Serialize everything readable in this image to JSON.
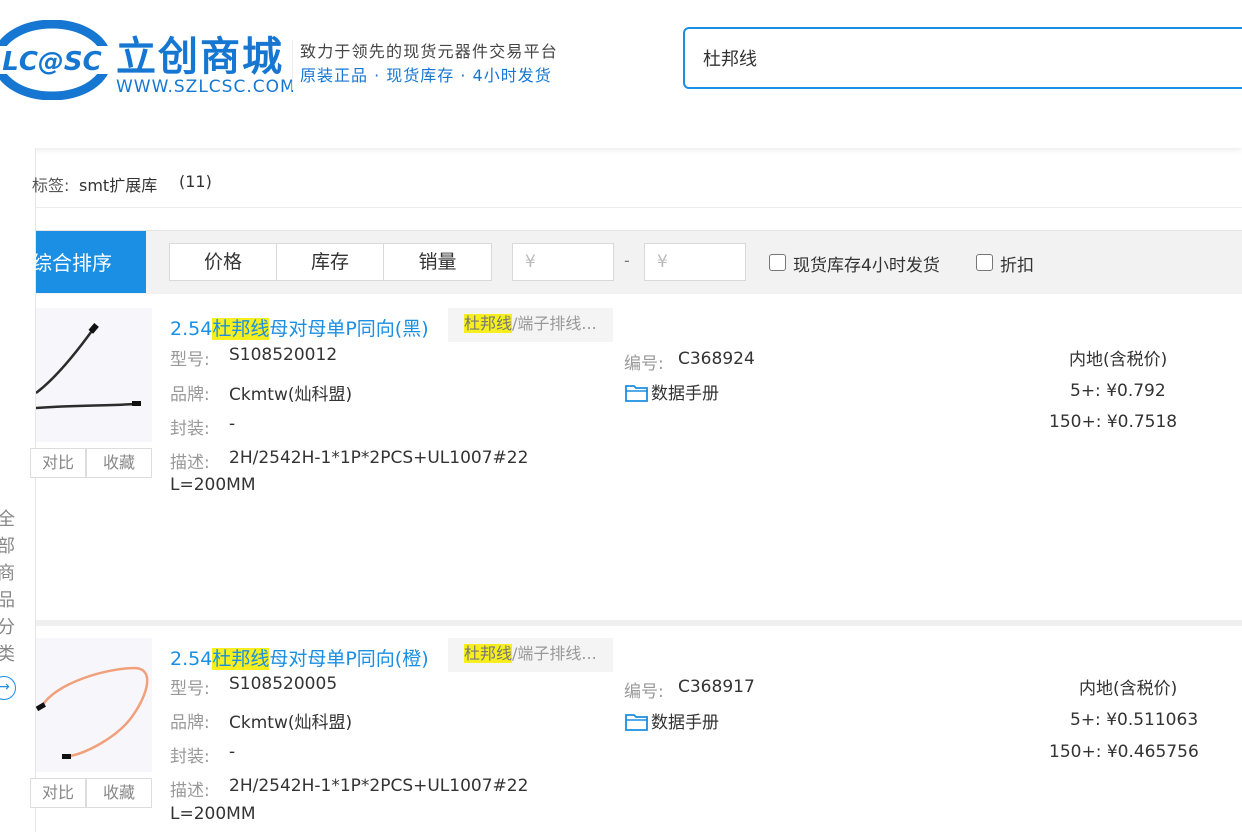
{
  "header": {
    "logo_text": "LC@SC",
    "brand_cn": "立创商城",
    "brand_url": "WWW.SZLCSC.COM",
    "slogan_line1": "致力于领先的现货元器件交易平台",
    "slogan_line2": "原装正品 · 现货库存 · 4小时发货",
    "search_value": "杜邦线"
  },
  "sidebar": {
    "label_chars": [
      "全",
      "部",
      "商",
      "品",
      "分",
      "类"
    ],
    "arrow": "→"
  },
  "tag_filter": {
    "prefix": "标签:",
    "tag": "smt扩展库",
    "count": "(11)"
  },
  "sort_bar": {
    "active": "综合排序",
    "options": [
      "价格",
      "库存",
      "销量"
    ],
    "price_min_placeholder": "¥",
    "price_max_placeholder": "¥",
    "dash": "-",
    "stock_checkbox_label": "现货库存4小时发货",
    "discount_checkbox_label": "折扣"
  },
  "products": [
    {
      "title_prefix": "2.54",
      "title_highlight": "杜邦线",
      "title_suffix": "母对母单P同向(黑)",
      "category_highlight": "杜邦线",
      "category_rest": "/端子排线...",
      "model_label": "型号:",
      "model": "S108520012",
      "brand_label": "品牌:",
      "brand": "Ckmtw(灿科盟)",
      "package_label": "封装:",
      "package": "-",
      "desc_label": "描述:",
      "desc_line1": "2H/2542H-1*1P*2PCS+UL1007#22",
      "desc_line2": "L=200MM",
      "code_label": "编号:",
      "code": "C368924",
      "datasheet": "数据手册",
      "compare": "对比",
      "favorite": "收藏",
      "price_header": "内地(含税价)",
      "prices": [
        {
          "qty": "5+:",
          "price": "¥0.792"
        },
        {
          "qty": "150+:",
          "price": "¥0.7518"
        }
      ],
      "wire_color": "#2b2b2b"
    },
    {
      "title_prefix": "2.54",
      "title_highlight": "杜邦线",
      "title_suffix": "母对母单P同向(橙)",
      "category_highlight": "杜邦线",
      "category_rest": "/端子排线...",
      "model_label": "型号:",
      "model": "S108520005",
      "brand_label": "品牌:",
      "brand": "Ckmtw(灿科盟)",
      "package_label": "封装:",
      "package": "-",
      "desc_label": "描述:",
      "desc_line1": "2H/2542H-1*1P*2PCS+UL1007#22",
      "desc_line2": "L=200MM",
      "code_label": "编号:",
      "code": "C368917",
      "datasheet": "数据手册",
      "compare": "对比",
      "favorite": "收藏",
      "price_header": "内地(含税价)",
      "prices": [
        {
          "qty": "5+:",
          "price": "¥0.511063"
        },
        {
          "qty": "150+:",
          "price": "¥0.465756"
        }
      ],
      "wire_color": "#f0a07a"
    }
  ]
}
